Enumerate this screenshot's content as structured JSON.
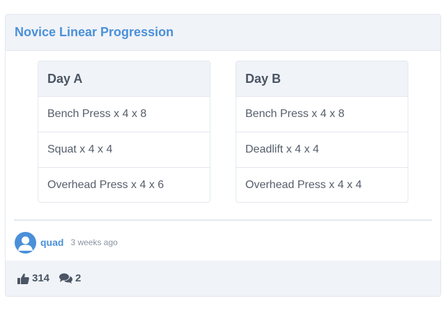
{
  "card": {
    "title": "Novice Linear Progression"
  },
  "days": [
    {
      "name": "Day A",
      "exercises": [
        "Bench Press x 4 x 8",
        "Squat x 4 x 4",
        "Overhead Press x 4 x 6"
      ]
    },
    {
      "name": "Day B",
      "exercises": [
        "Bench Press x 4 x 8",
        "Deadlift x 4 x 4",
        "Overhead Press x 4 x 4"
      ]
    }
  ],
  "author": {
    "name": "quad",
    "posted": "3 weeks ago"
  },
  "stats": {
    "likes": "314",
    "comments": "2"
  },
  "colors": {
    "accent": "#4a90d9",
    "header_bg": "#f0f3f8",
    "text": "#4b5563"
  }
}
